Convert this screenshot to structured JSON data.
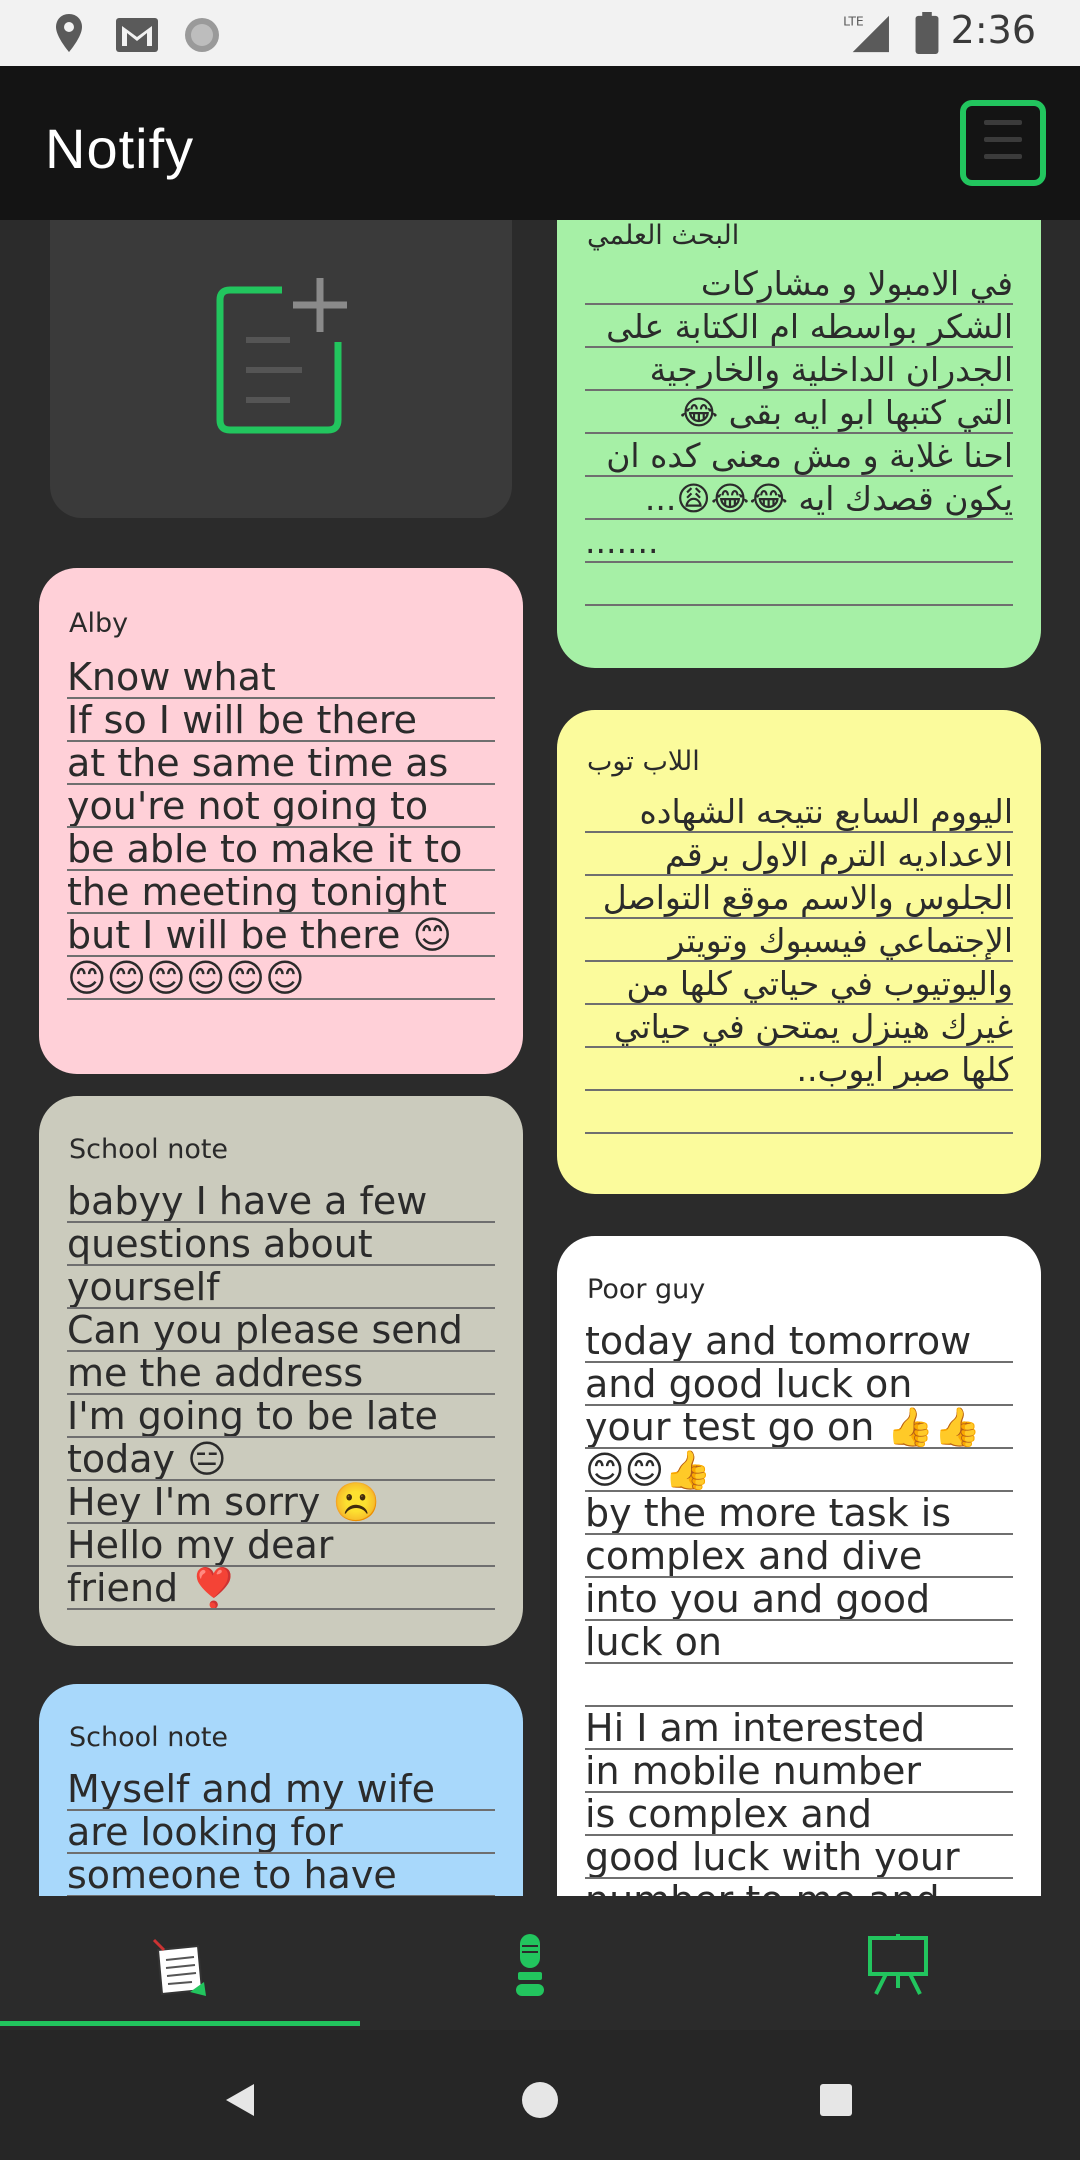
{
  "status_bar": {
    "time": "2:36",
    "icons": [
      "location-icon",
      "gmail-icon",
      "sync-icon",
      "lte-signal-icon",
      "battery-icon"
    ]
  },
  "app_bar": {
    "title": "Notify",
    "menu_icon": "hamburger-menu-icon"
  },
  "notes_left": [
    {
      "title": "Alby",
      "color": "#ffd0d8",
      "lines": [
        "Know what",
        "If so I will be there",
        "at the same time as",
        "you're not going to",
        "be able to make it to",
        "the meeting tonight",
        "but I will be there 😊",
        "😊😊😊😊😊😊"
      ]
    },
    {
      "title": "School note",
      "color": "#cbcbbd",
      "lines": [
        "babyy I have a few",
        "questions about",
        "yourself",
        "Can you please send",
        "me the address",
        "I'm going to be late",
        "today 😑",
        "Hey I'm sorry ☹️",
        "Hello my dear",
        "friend ❣️"
      ]
    },
    {
      "title": "School note",
      "color": "#a8d8fb",
      "lines": [
        "Myself and my wife",
        "are looking for",
        "someone to have"
      ]
    }
  ],
  "notes_right": [
    {
      "title": "البحث العلمي",
      "color": "#a6f0a6",
      "lines": [
        "في الامبولا و مشاركات",
        "الشكر بواسطه ام الكتابة على",
        "الجدران الداخلية والخارجية",
        "التي كتبها ابو ايه بقى 😂",
        "احنا غلابة و مش معنى كده ان",
        "يكون قصدك ايه 😂😂😩...",
        ".......",
        ""
      ]
    },
    {
      "title": "اللاب توب",
      "color": "#fbfb9c",
      "lines": [
        "اليووم السابع نتيجه الشهاده",
        "الاعداديه الترم الاول برقم",
        "الجلوس والاسم موقع التواصل",
        "الإجتماعي فيسبوك وتويتر",
        "واليوتيوب في حياتي كلها من",
        "غيرك هينزل يمتحن في حياتي",
        "كلها صبر ايوب..",
        ""
      ]
    },
    {
      "title": "Poor guy",
      "color": "#ffffff",
      "lines": [
        "today and tomorrow",
        "and good luck on",
        "your test go on 👍👍",
        "😊😊👍",
        "by the more task is",
        "complex and dive",
        "into you and good",
        "luck on",
        "",
        "Hi I am interested",
        "in mobile number",
        "is complex and",
        "good luck with your",
        "number to me and"
      ]
    }
  ],
  "bottom_nav": {
    "items": [
      "notes-icon",
      "microphone-icon",
      "whiteboard-icon"
    ],
    "active": 0
  },
  "system_nav": [
    "back-icon",
    "home-icon",
    "recents-icon"
  ],
  "colors": {
    "accent": "#22c55e",
    "app_bar": "#141414",
    "background": "#2b2b2b"
  }
}
